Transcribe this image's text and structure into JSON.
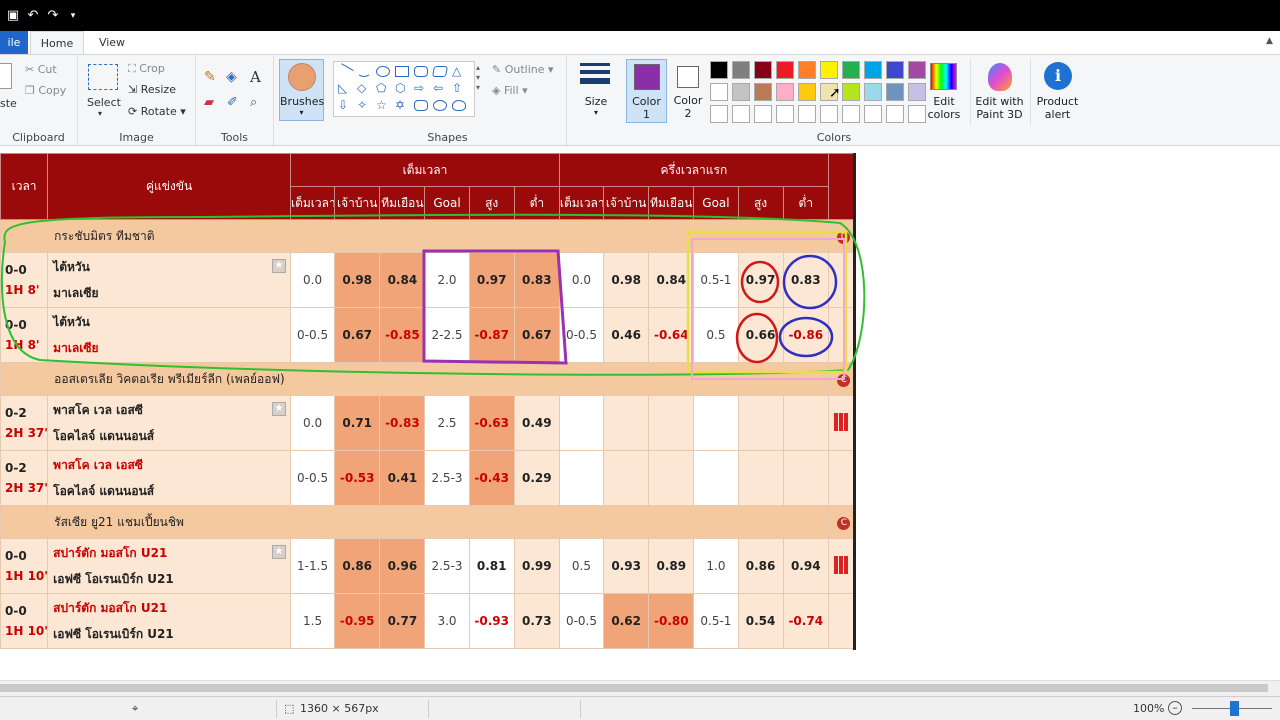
{
  "app": {
    "tabs": {
      "file": "ile",
      "home": "Home",
      "view": "View"
    }
  },
  "ribbon": {
    "clipboard": {
      "paste": "ste",
      "cut": "Cut",
      "copy": "Copy",
      "label": "Clipboard"
    },
    "image": {
      "select": "Select",
      "crop": "Crop",
      "resize": "Resize",
      "rotate": "Rotate",
      "label": "Image"
    },
    "tools": {
      "label": "Tools",
      "text_tool": "A"
    },
    "brushes": {
      "label": "Brushes"
    },
    "shapes": {
      "outline": "Outline",
      "fill": "Fill",
      "label": "Shapes"
    },
    "size": {
      "label": "Size"
    },
    "color1": {
      "label": "Color",
      "num": "1",
      "value": "#8b2fa8"
    },
    "color2": {
      "label": "Color",
      "num": "2",
      "value": "#ffffff"
    },
    "colors": {
      "label": "Colors",
      "row1": [
        "#000000",
        "#7f7f7f",
        "#880015",
        "#ed1c24",
        "#ff7f27",
        "#fff200",
        "#22b14c",
        "#00a2e8",
        "#3f48cc",
        "#a349a4"
      ],
      "row2": [
        "#ffffff",
        "#c3c3c3",
        "#b97a57",
        "#ffaec9",
        "#ffc90e",
        "#efe4b0",
        "#b5e61d",
        "#99d9ea",
        "#7092be",
        "#c8bfe7"
      ]
    },
    "edit_colors": {
      "line1": "Edit",
      "line2": "colors"
    },
    "paint3d": {
      "line1": "Edit with",
      "line2": "Paint 3D"
    },
    "product_alert": {
      "line1": "Product",
      "line2": "alert"
    }
  },
  "table": {
    "head": {
      "time": "เวลา",
      "match": "คู่แข่งขัน",
      "full": "เต็มเวลา",
      "half": "ครึ่งเวลาแรก",
      "cols": [
        "เต็มเวลา",
        "เจ้าบ้าน",
        "ทีมเยือน",
        "Goal",
        "สูง",
        "ต่ำ",
        "เต็มเวลา",
        "เจ้าบ้าน",
        "ทีมเยือน",
        "Goal",
        "สูง",
        "ต่ำ"
      ]
    },
    "leagues": [
      {
        "name": "กระชับมิตร ทีมชาติ",
        "rows": [
          {
            "score": "0-0",
            "time": "1H 8'",
            "home": "ไต้หวัน",
            "away": "มาเลเซีย",
            "home_red": false,
            "away_red": false,
            "full": [
              "0.0",
              "0.98",
              "0.84",
              "2.0",
              "0.97",
              "0.83"
            ],
            "half": [
              "0.0",
              "0.98",
              "0.84",
              "0.5-1",
              "0.97",
              "0.83"
            ]
          },
          {
            "score": "0-0",
            "time": "1H 8'",
            "home": "ไต้หวัน",
            "away": "มาเลเซีย",
            "home_red": false,
            "away_red": true,
            "full": [
              "0-0.5",
              "0.67",
              "-0.85",
              "2-2.5",
              "-0.87",
              "0.67"
            ],
            "half": [
              "0-0.5",
              "0.46",
              "-0.64",
              "0.5",
              "0.66",
              "-0.86"
            ]
          }
        ]
      },
      {
        "name": "ออสเตรเลีย วิคตอเรีย พรีเมียร์ลีก (เพลย์ออฟ)",
        "rows": [
          {
            "score": "0-2",
            "time": "2H 37'",
            "home": "พาสโค เวล เอสซี",
            "away": "โอคไลจ์ แดนนอนส์",
            "home_red": false,
            "away_red": false,
            "full": [
              "0.0",
              "0.71",
              "-0.83",
              "2.5",
              "-0.63",
              "0.49"
            ],
            "half": [
              "",
              "",
              "",
              "",
              "",
              ""
            ]
          },
          {
            "score": "0-2",
            "time": "2H 37'",
            "home": "พาสโค เวล เอสซี",
            "away": "โอคไลจ์ แดนนอนส์",
            "home_red": true,
            "away_red": false,
            "full": [
              "0-0.5",
              "-0.53",
              "0.41",
              "2.5-3",
              "-0.43",
              "0.29"
            ],
            "half": [
              "",
              "",
              "",
              "",
              "",
              ""
            ]
          }
        ]
      },
      {
        "name": "รัสเซีย ยู21 แชมเปี้ยนชิพ",
        "rows": [
          {
            "score": "0-0",
            "time": "1H 10'",
            "home": "สปาร์ตัก มอสโก U21",
            "away": "เอฟซี โอเรนเบิร์ก U21",
            "home_red": true,
            "away_red": false,
            "full": [
              "1-1.5",
              "0.86",
              "0.96",
              "2.5-3",
              "0.81",
              "0.99"
            ],
            "half": [
              "0.5",
              "0.93",
              "0.89",
              "1.0",
              "0.86",
              "0.94"
            ]
          },
          {
            "score": "0-0",
            "time": "1H 10'",
            "home": "สปาร์ตัก มอสโก U21",
            "away": "เอฟซี โอเรนเบิร์ก U21",
            "home_red": true,
            "away_red": false,
            "full": [
              "1.5",
              "-0.95",
              "0.77",
              "3.0",
              "-0.93",
              "0.73"
            ],
            "half": [
              "0-0.5",
              "0.62",
              "-0.80",
              "0.5-1",
              "0.54",
              "-0.74"
            ]
          }
        ]
      }
    ]
  },
  "status": {
    "dimensions": "1360 × 567px",
    "zoom": "100%"
  }
}
